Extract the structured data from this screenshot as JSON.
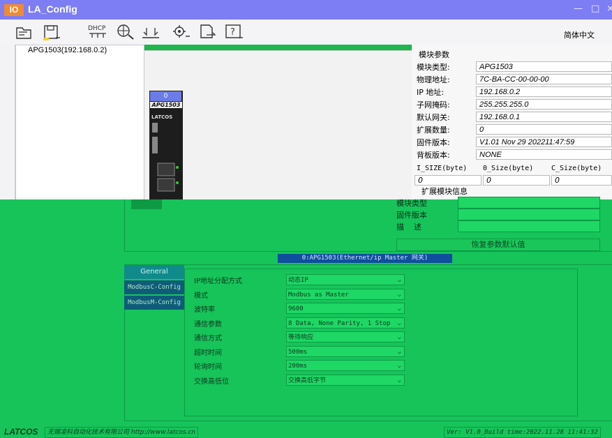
{
  "app": {
    "badge": "IO",
    "title": "LA_Config",
    "minimize": "—",
    "maximize": "□",
    "close": "×"
  },
  "toolbar": {
    "language": "简体中文",
    "dhcp_label": "DHCP"
  },
  "tree": {
    "item": "APG1503(192.168.0.2)"
  },
  "module": {
    "slot": "0",
    "model": "APG1503",
    "brand": "LATCOS"
  },
  "params": {
    "title": "模块参数",
    "rows": [
      {
        "label": "模块类型:",
        "value": "APG1503"
      },
      {
        "label": "物理地址:",
        "value": "7C-BA-CC-00-00-00"
      },
      {
        "label": "IP 地址:",
        "value": "192.168.0.2"
      },
      {
        "label": "子网掩码:",
        "value": "255.255.255.0"
      },
      {
        "label": "默认网关:",
        "value": "192.168.0.1"
      },
      {
        "label": "扩展数量:",
        "value": "0"
      },
      {
        "label": "固件版本:",
        "value": "V1.01 Nov 29 202211:47:59"
      },
      {
        "label": "背板版本:",
        "value": "NONE"
      }
    ],
    "size_headers": [
      "I_SIZE(byte)",
      "0_Size(byte)",
      "C_Size(byte)"
    ],
    "size_values": [
      "0",
      "0",
      "0"
    ],
    "ext_title": "扩展模块信息"
  },
  "ext": {
    "type_label": "模块类型",
    "fw_label": "固件版本",
    "desc_label": "描    述",
    "restore": "恢复参数默认值"
  },
  "module_header": "0:APG1503(Ethernet/ip Master 网关)",
  "tabs": {
    "general": "General",
    "c": "ModbusC-Config",
    "m": "ModbusM-Config"
  },
  "form": [
    {
      "label": "IP地址分配方式",
      "value": "动态IP"
    },
    {
      "label": "模式",
      "value": "Modbus as Master"
    },
    {
      "label": "波特率",
      "value": "9600"
    },
    {
      "label": "通信参数",
      "value": "8 Data, None Parity, 1 Stop"
    },
    {
      "label": "通信方式",
      "value": "等待响应"
    },
    {
      "label": "超时时间",
      "value": "500ms"
    },
    {
      "label": "轮询时间",
      "value": "200ms"
    },
    {
      "label": "交换高低位",
      "value": "交换高低字节"
    }
  ],
  "footer": {
    "logo": "LATCOS",
    "company": "无锡凌科自动化技术有限公司 http://www.latcos.cn",
    "version": "Ver: V1.0_Build time:2022.11.28 11:41:32"
  }
}
